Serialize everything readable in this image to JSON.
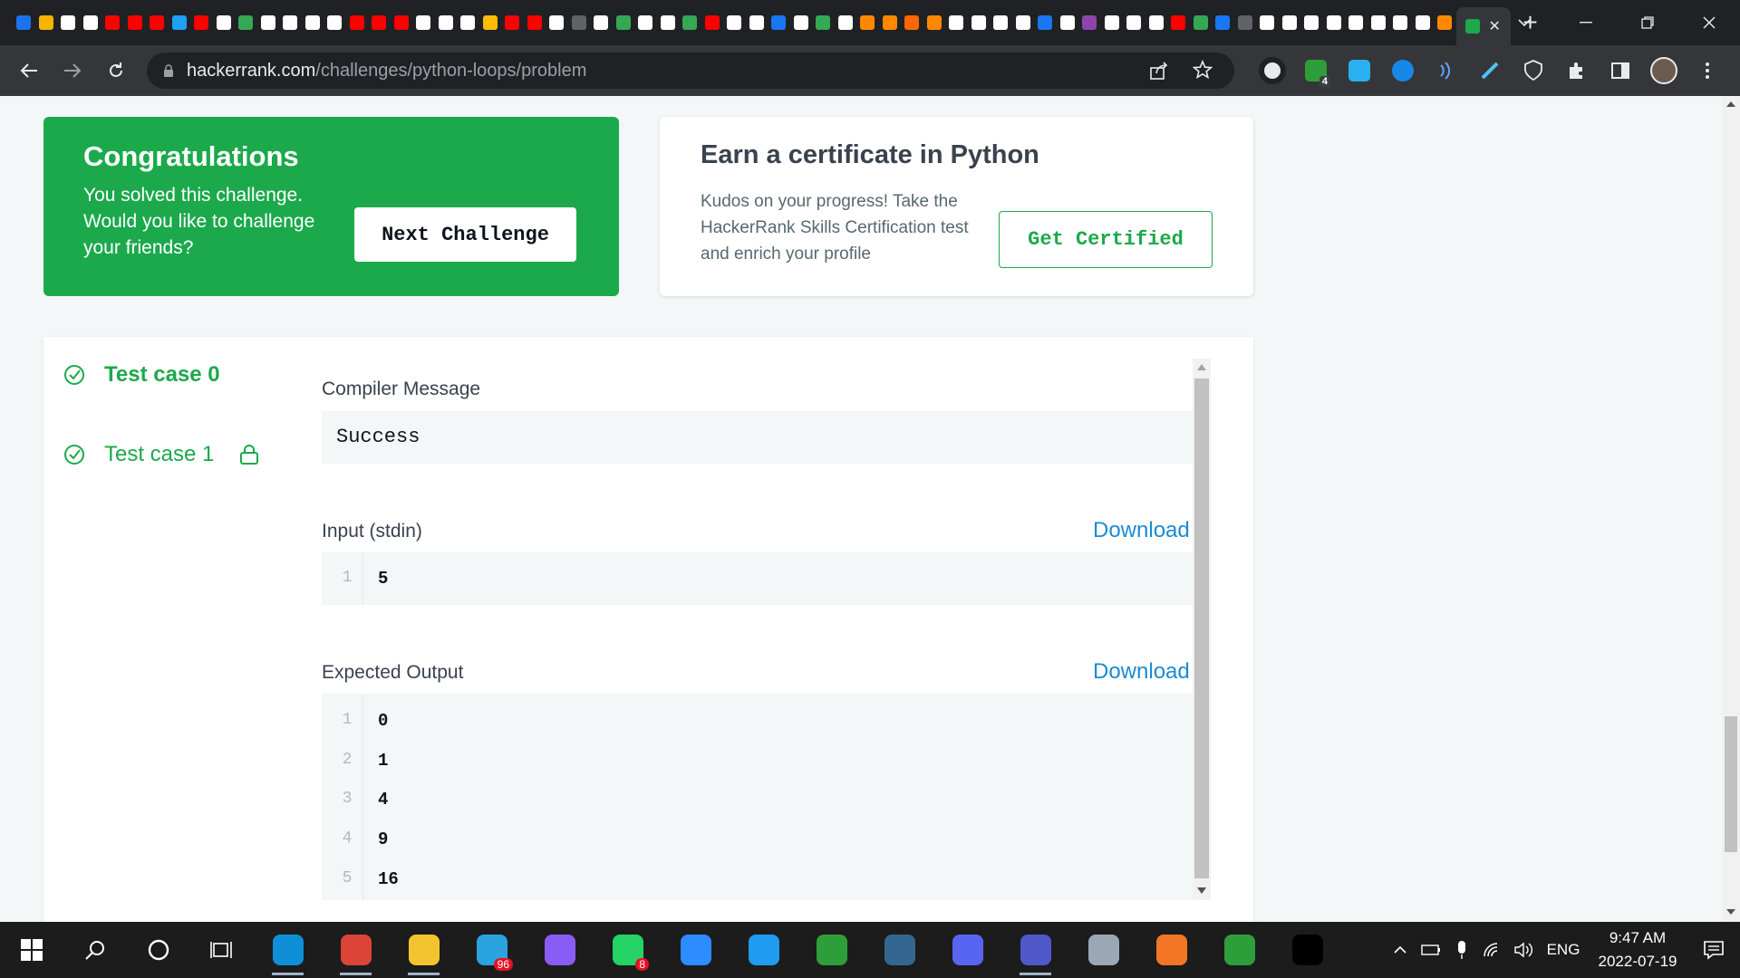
{
  "browser": {
    "address_domain": "hackerrank.com",
    "address_path": "/challenges/python-loops/problem",
    "close_tab_glyph": "✕",
    "new_tab_glyph": "+",
    "extension_badge": "4",
    "mini_tab_colors": [
      "#1a73e8",
      "#f4b400",
      "#ffffff",
      "#ffffff",
      "#ff0000",
      "#ff0000",
      "#ff0000",
      "#1da1f2",
      "#ff0000",
      "#ffffff",
      "#34a853",
      "#ffffff",
      "#ffffff",
      "#ffffff",
      "#ffffff",
      "#ff0000",
      "#ff0000",
      "#ff0000",
      "#ffffff",
      "#ffffff",
      "#ffffff",
      "#fbbc05",
      "#ff0000",
      "#ff0000",
      "#ffffff",
      "#5f6368",
      "#ffffff",
      "#34a853",
      "#ffffff",
      "#ffffff",
      "#34a853",
      "#ff0000",
      "#ffffff",
      "#ffffff",
      "#1877f2",
      "#ffffff",
      "#34a853",
      "#ffffff",
      "#ff8800",
      "#ff8800",
      "#ff6600",
      "#ff8800",
      "#ffffff",
      "#ffffff",
      "#ffffff",
      "#ffffff",
      "#1877f2",
      "#ffffff",
      "#8e44ad",
      "#ffffff",
      "#ffffff",
      "#ffffff",
      "#ff0000",
      "#34a853",
      "#1877f2",
      "#5f6368",
      "#ffffff",
      "#ffffff",
      "#ffffff",
      "#ffffff",
      "#ffffff",
      "#ffffff",
      "#ffffff",
      "#ffffff",
      "#ff8800"
    ]
  },
  "success_card": {
    "title": "Congratulations",
    "line1": "You solved this challenge.",
    "line2": "Would you like to challenge",
    "line3": "your friends?",
    "button": "Next Challenge"
  },
  "cert_card": {
    "title": "Earn a certificate in Python",
    "line1": "Kudos on your progress! Take the",
    "line2": "HackerRank Skills Certification test",
    "line3": "and enrich your profile",
    "button": "Get Certified"
  },
  "test_cases": [
    {
      "label": "Test case 0",
      "locked": false
    },
    {
      "label": "Test case 1",
      "locked": true
    }
  ],
  "results": {
    "compiler_label": "Compiler Message",
    "compiler_message": "Success",
    "input_label": "Input (stdin)",
    "download_label": "Download",
    "input_lines": [
      {
        "n": "1",
        "v": "5"
      }
    ],
    "output_label": "Expected Output",
    "output_lines": [
      {
        "n": "1",
        "v": "0"
      },
      {
        "n": "2",
        "v": "1"
      },
      {
        "n": "3",
        "v": "4"
      },
      {
        "n": "4",
        "v": "9"
      },
      {
        "n": "5",
        "v": "16"
      }
    ]
  },
  "taskbar": {
    "apps": [
      {
        "name": "edge",
        "color": "#0f8fd8"
      },
      {
        "name": "chrome",
        "color": "#db4437"
      },
      {
        "name": "file-explorer",
        "color": "#f4c430"
      },
      {
        "name": "telegram",
        "color": "#2aa3de",
        "badge": "96"
      },
      {
        "name": "messenger",
        "color": "#8a5cf6"
      },
      {
        "name": "whatsapp",
        "color": "#25d366",
        "badge": "8"
      },
      {
        "name": "zoom",
        "color": "#2d8cff"
      },
      {
        "name": "vscode",
        "color": "#1f9cf0"
      },
      {
        "name": "app-ring",
        "color": "#2e9e3a"
      },
      {
        "name": "postgres",
        "color": "#336791"
      },
      {
        "name": "discord",
        "color": "#5865f2"
      },
      {
        "name": "teams",
        "color": "#5059c9"
      },
      {
        "name": "monitor-app",
        "color": "#9aa7b4"
      },
      {
        "name": "jupyter",
        "color": "#f37626"
      },
      {
        "name": "app-ring-2",
        "color": "#2e9e3a"
      },
      {
        "name": "terminal",
        "color": "#000000"
      }
    ],
    "language": "ENG",
    "time": "9:47 AM",
    "date": "2022-07-19"
  }
}
